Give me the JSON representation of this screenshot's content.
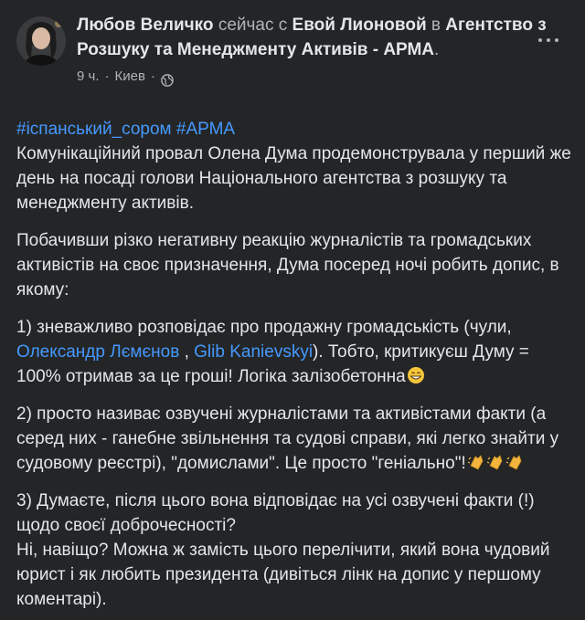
{
  "post": {
    "author": "Любов Величко",
    "with_prefix": "сейчас с",
    "with_person": "Евой Лионовой",
    "at_prefix": "в",
    "agency": "Агентство з Розшуку та Менеджменту Активів - АРМА",
    "agency_suffix": ".",
    "time": "9 ч.",
    "dot": "·",
    "location": "Киев",
    "hashtags": [
      "#іспанський_сором",
      "#АРМА"
    ],
    "paragraphs": {
      "p1": "Комунікаційний провал Олена Дума продемонструвала у перший же день на посаді голови Національного агентства з розшуку та менеджменту активів.",
      "p2": "Побачивши різко негативну реакцію журналістів та громадських активістів на своє призначення, Дума посеред ночі робить допис, в якому:",
      "p3_a": "1) зневажливо розповідає про продажну громадськість (чули,",
      "p3_link1": "Олександр Лємєнов",
      "p3_sep": ",",
      "p3_link2": "Glib Kanievskyi",
      "p3_b": "). Тобто, критикуєш Думу = 100% отримав за це гроші! Логіка залізобетонна",
      "p4_a": "2) просто називає озвучені журналістами та активістами факти (а серед них - ганебне звільнення та судові справи, які легко знайти у судовому реєстрі),  \"домислами\". Це просто \"геніально\"!",
      "p5_a": "3) Думаєте, після цього вона відповідає на усі озвучені факти (!) щодо своєї доброчесності?",
      "p5_b": "Ні, навіщо? Можна ж замість цього перелічити, який вона чудовий юрист і як любить президента (дивіться лінк на допис у першому коментарі)."
    }
  },
  "icons": {
    "globe": "globe-icon",
    "more": "more-horizontal-icon",
    "grin": "grinning-face-icon",
    "clap": "clapping-hands-icon"
  },
  "colors": {
    "background": "#242526",
    "text": "#e4e6eb",
    "secondary": "#b0b3b8",
    "link": "#4599ff"
  }
}
